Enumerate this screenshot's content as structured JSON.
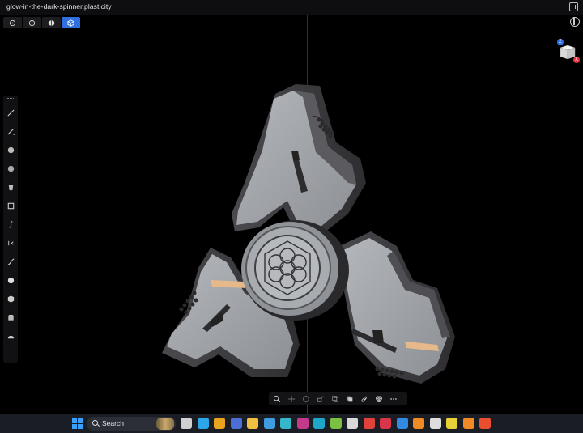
{
  "window": {
    "title": "glow-in-the-dark-spinner.plasticity"
  },
  "modebar": {
    "modes": [
      {
        "icon": "vertex-mode-icon",
        "active": false
      },
      {
        "icon": "edge-mode-icon",
        "active": false
      },
      {
        "icon": "face-mode-icon",
        "active": false
      },
      {
        "icon": "solid-mode-icon",
        "active": true
      }
    ]
  },
  "navcube": {
    "z_label": "Z",
    "x_label": "X"
  },
  "left_toolbar": {
    "tools": [
      "line-icon",
      "curve-icon",
      "circle-icon",
      "sphere-icon",
      "cylinder-icon",
      "box-icon",
      "spiral-icon",
      "mirror-icon",
      "fillet-icon",
      "circle-filled-icon",
      "cube-icon",
      "stack-icon",
      "cap-icon"
    ]
  },
  "bottom_toolbar": {
    "tools": [
      "search-icon",
      "move-icon",
      "rotate-icon",
      "scale-icon",
      "duplicate-icon",
      "boolean-icon",
      "attach-icon",
      "material-icon",
      "more-icon"
    ]
  },
  "taskbar": {
    "search_label": "Search",
    "apps": [
      {
        "name": "task-view-icon",
        "color": "#d0d0d0"
      },
      {
        "name": "pen-app-icon",
        "color": "#2aa7e8"
      },
      {
        "name": "chrome-icon",
        "color": "#e9a31f"
      },
      {
        "name": "teams-icon",
        "color": "#4b6fd6"
      },
      {
        "name": "explorer-icon",
        "color": "#f0c040"
      },
      {
        "name": "app-blue-icon",
        "color": "#3d9de0"
      },
      {
        "name": "app-cyan-icon",
        "color": "#36b6c9"
      },
      {
        "name": "intellij-icon",
        "color": "#c33a8a"
      },
      {
        "name": "affinity-icon",
        "color": "#1ea7c9"
      },
      {
        "name": "app-green-icon",
        "color": "#7bc043"
      },
      {
        "name": "app-g-icon",
        "color": "#d8d8d8"
      },
      {
        "name": "app-red-f-icon",
        "color": "#e0413b"
      },
      {
        "name": "app-red-f2-icon",
        "color": "#d8344a"
      },
      {
        "name": "app-e-icon",
        "color": "#2f8ae0"
      },
      {
        "name": "blender-icon",
        "color": "#f08a24"
      },
      {
        "name": "inkscape-icon",
        "color": "#dddddd"
      },
      {
        "name": "app-teal-icon",
        "color": "#e8d036"
      },
      {
        "name": "blender2-icon",
        "color": "#f08a24"
      },
      {
        "name": "brave-icon",
        "color": "#e94f2e"
      }
    ]
  },
  "colors": {
    "accent": "#2f6fe0",
    "model_body": "#9ea1a6",
    "model_edge": "#3f3f43",
    "model_accent": "#e7b98a"
  }
}
